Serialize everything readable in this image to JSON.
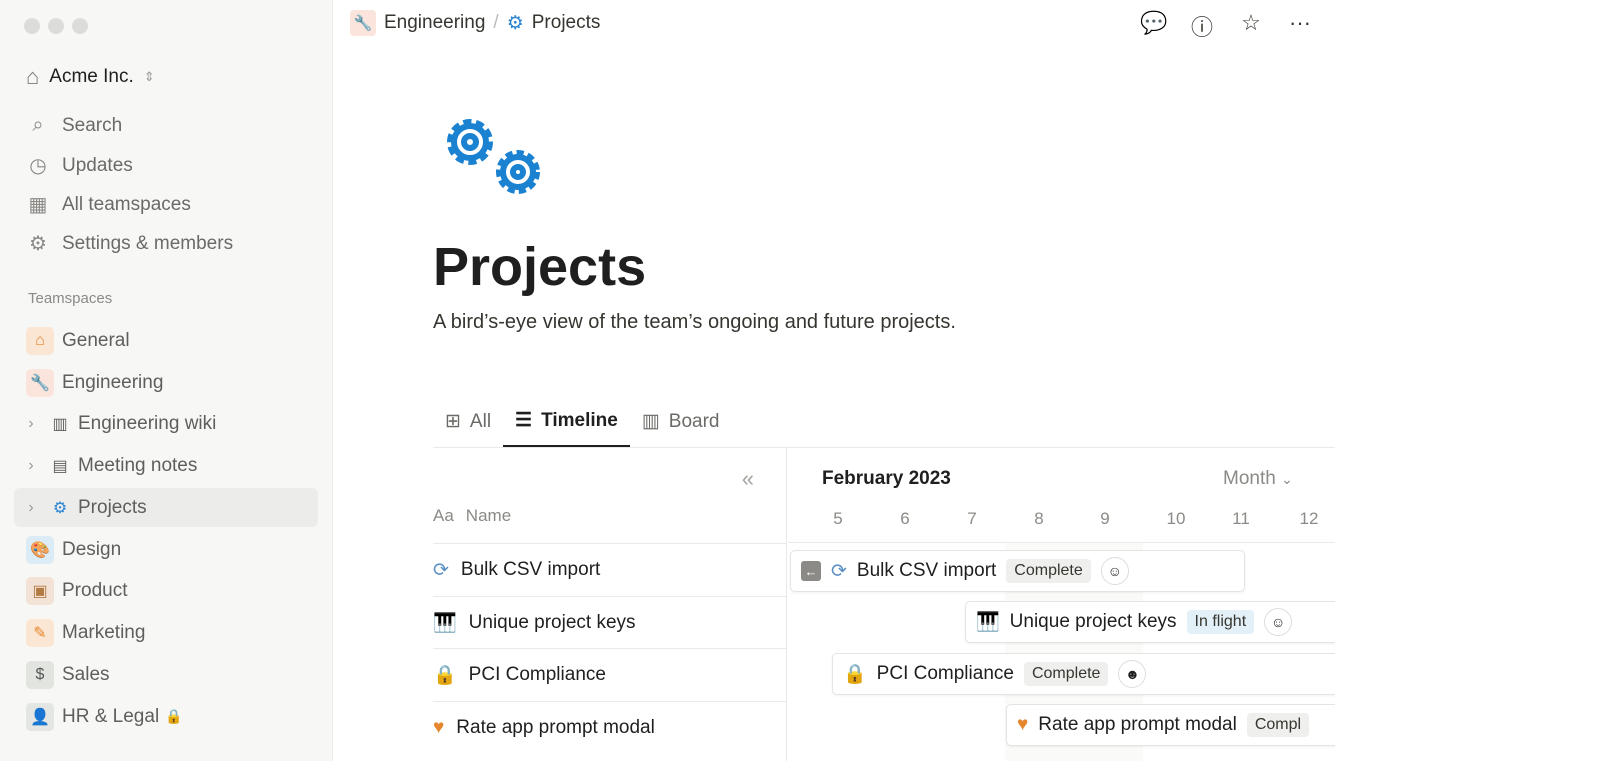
{
  "sidebar": {
    "workspace": "Acme Inc.",
    "nav": [
      {
        "label": "Search",
        "icon": "search-icon"
      },
      {
        "label": "Updates",
        "icon": "clock-icon"
      },
      {
        "label": "All teamspaces",
        "icon": "building-icon"
      },
      {
        "label": "Settings & members",
        "icon": "gear-icon"
      }
    ],
    "section": "Teamspaces",
    "items": [
      {
        "label": "General",
        "icon": "house-icon"
      },
      {
        "label": "Engineering",
        "icon": "wrench-icon"
      },
      {
        "label": "Engineering wiki",
        "icon": "books-icon"
      },
      {
        "label": "Meeting notes",
        "icon": "notebook-icon"
      },
      {
        "label": "Projects",
        "icon": "gears-icon"
      },
      {
        "label": "Design",
        "icon": "palette-icon"
      },
      {
        "label": "Product",
        "icon": "package-icon"
      },
      {
        "label": "Marketing",
        "icon": "pencil-icon"
      },
      {
        "label": "Sales",
        "icon": "dollar-icon"
      },
      {
        "label": "HR & Legal",
        "icon": "person-icon"
      }
    ]
  },
  "breadcrumb": {
    "parent": "Engineering",
    "sep": "/",
    "current": "Projects"
  },
  "page": {
    "title": "Projects",
    "description": "A bird’s-eye view of the team’s ongoing and future projects."
  },
  "tabs": [
    {
      "label": "All"
    },
    {
      "label": "Timeline"
    },
    {
      "label": "Board"
    }
  ],
  "table": {
    "name_prefix": "Aa",
    "name_header": "Name",
    "rows": [
      "Bulk CSV import",
      "Unique project keys",
      "PCI Compliance",
      "Rate app prompt modal"
    ]
  },
  "timeline": {
    "month": "February 2023",
    "scale": "Month",
    "days": [
      "5",
      "6",
      "7",
      "8",
      "9",
      "10",
      "11",
      "12"
    ],
    "bars": [
      {
        "name": "Bulk CSV import",
        "status": "Complete"
      },
      {
        "name": "Unique project keys",
        "status": "In flight"
      },
      {
        "name": "PCI Compliance",
        "status": "Complete"
      },
      {
        "name": "Rate app prompt modal",
        "status": "Compl"
      }
    ]
  }
}
